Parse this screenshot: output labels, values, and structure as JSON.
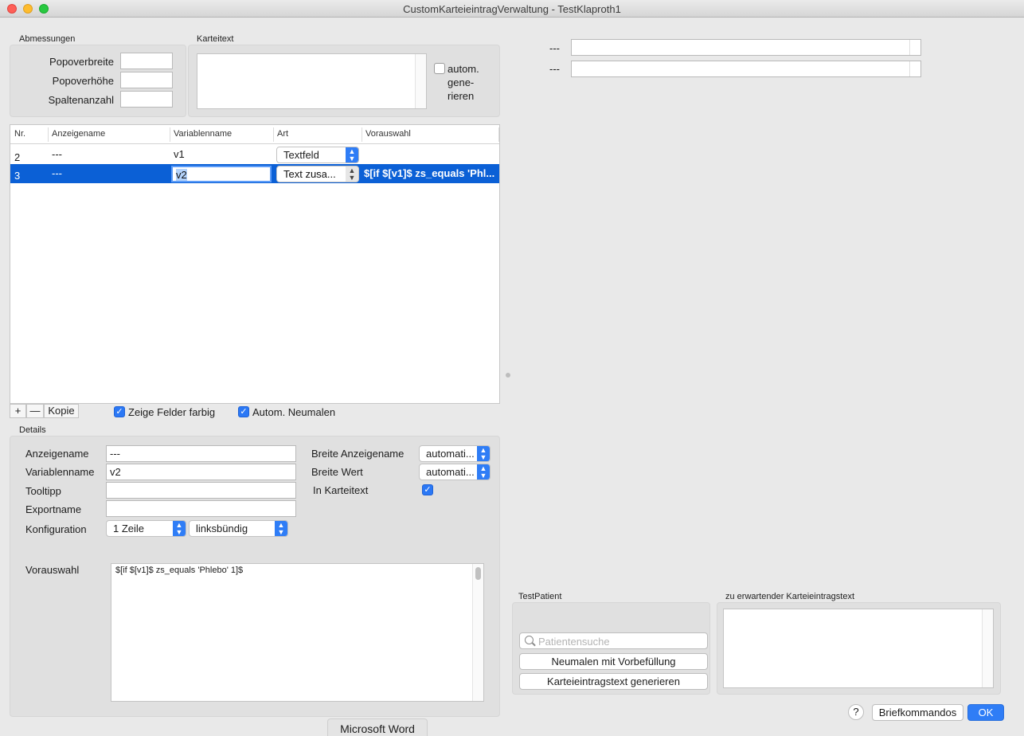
{
  "window": {
    "title": "CustomKarteieintragVerwaltung - TestKlaproth1"
  },
  "dimensions": {
    "title": "Abmessungen",
    "popover_width_label": "Popoverbreite",
    "popover_height_label": "Popoverhöhe",
    "columns_label": "Spaltenanzahl",
    "popover_width_value": "",
    "popover_height_value": "",
    "columns_value": ""
  },
  "karteitext": {
    "title": "Karteitext",
    "value": "",
    "auto_generate_label_line1": "autom.",
    "auto_generate_label_line2": "gene-",
    "auto_generate_label_line3": "rieren",
    "auto_generate_checked": false
  },
  "table": {
    "columns": [
      "Nr.",
      "Anzeigename",
      "Variablenname",
      "Art",
      "Vorauswahl"
    ],
    "rows": [
      {
        "nr": "2",
        "anzeigename": "---",
        "variablenname": "v1",
        "art": "Textfeld",
        "vorauswahl": "",
        "selected": false
      },
      {
        "nr": "3",
        "anzeigename": "---",
        "variablenname": "v2",
        "art": "Text zusa...",
        "vorauswahl": "$[if $[v1]$ zs_equals 'Phl...",
        "selected": true
      }
    ]
  },
  "table_controls": {
    "add": "+",
    "remove": "—",
    "copy": "Kopie",
    "show_colored_label": "Zeige Felder farbig",
    "show_colored_checked": true,
    "auto_redraw_label": "Autom. Neumalen",
    "auto_redraw_checked": true
  },
  "details": {
    "title": "Details",
    "display_name_label": "Anzeigename",
    "display_name_value": "---",
    "variable_name_label": "Variablenname",
    "variable_name_value": "v2",
    "tooltip_label": "Tooltipp",
    "tooltip_value": "",
    "export_name_label": "Exportname",
    "export_name_value": "",
    "config_label": "Konfiguration",
    "config_lines": "1 Zeile",
    "config_align": "linksbündig",
    "width_display_label": "Breite Anzeigename",
    "width_display_value": "automati...",
    "width_value_label": "Breite Wert",
    "width_value_value": "automati...",
    "in_karteitext_label": "In Karteitext",
    "in_karteitext_checked": true,
    "preselection_label": "Vorauswahl",
    "preselection_value": "$[if $[v1]$ zs_equals 'Phlebo' 1]$"
  },
  "preview": {
    "row1_label": "---",
    "row2_label": "---"
  },
  "test_patient": {
    "title": "TestPatient",
    "search_placeholder": "Patientensuche",
    "redraw_button": "Neumalen mit Vorbefüllung",
    "generate_button": "Karteieintragstext generieren"
  },
  "expected": {
    "title": "zu erwartender Karteieintragstext",
    "value": ""
  },
  "footer": {
    "help": "?",
    "commands_button": "Briefkommandos",
    "ok_button": "OK"
  },
  "taskbar": {
    "label": "Microsoft Word"
  },
  "colors": {
    "accent": "#2f7df6",
    "selection": "#0b60d6"
  }
}
